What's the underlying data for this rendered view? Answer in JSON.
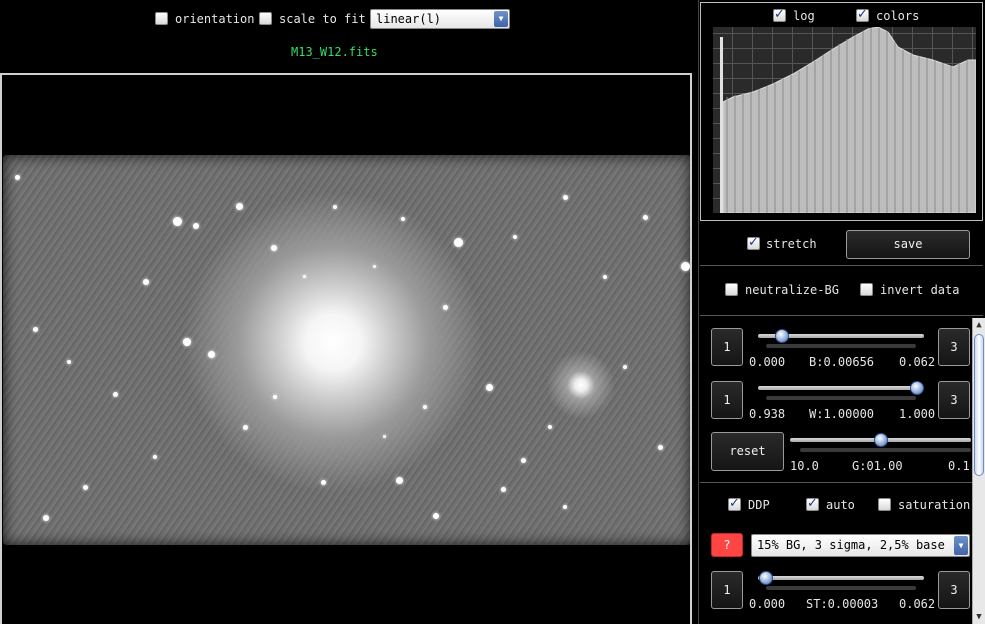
{
  "toolbar": {
    "orientation_label": "orientation",
    "orientation_checked": false,
    "scale_label": "scale to fit",
    "scale_checked": false,
    "scale_select_value": "linear(l)"
  },
  "image": {
    "filename": "M13_W12.fits"
  },
  "histogram": {
    "log_label": "log",
    "log_checked": true,
    "colors_label": "colors",
    "colors_checked": true
  },
  "controls": {
    "stretch_label": "stretch",
    "stretch_checked": true,
    "save_label": "save",
    "neutralize_label": "neutralize-BG",
    "neutralize_checked": false,
    "invert_label": "invert data",
    "invert_checked": false
  },
  "sliders": {
    "black": {
      "left_btn": "1",
      "right_btn": "3",
      "min": "0.000",
      "label": "B:0.00656",
      "max": "0.062"
    },
    "white": {
      "left_btn": "1",
      "right_btn": "3",
      "min": "0.938",
      "label": "W:1.00000",
      "max": "1.000"
    },
    "gamma": {
      "reset_label": "reset",
      "min": "10.0",
      "label": "G:01.00",
      "max": "0.1"
    },
    "stretch": {
      "left_btn": "1",
      "right_btn": "3",
      "min": "0.000",
      "label": "ST:0.00003",
      "max": "0.062"
    }
  },
  "ddp": {
    "ddp_label": "DDP",
    "ddp_checked": true,
    "auto_label": "auto",
    "auto_checked": true,
    "saturation_label": "saturation",
    "saturation_checked": false,
    "help_label": "?",
    "preset_value": "15% BG, 3 sigma, 2,5% base"
  },
  "colors": {
    "filename_color": "#33dd66",
    "help_button_color": "#ff4444",
    "knob_color": "#8aa9d6"
  }
}
